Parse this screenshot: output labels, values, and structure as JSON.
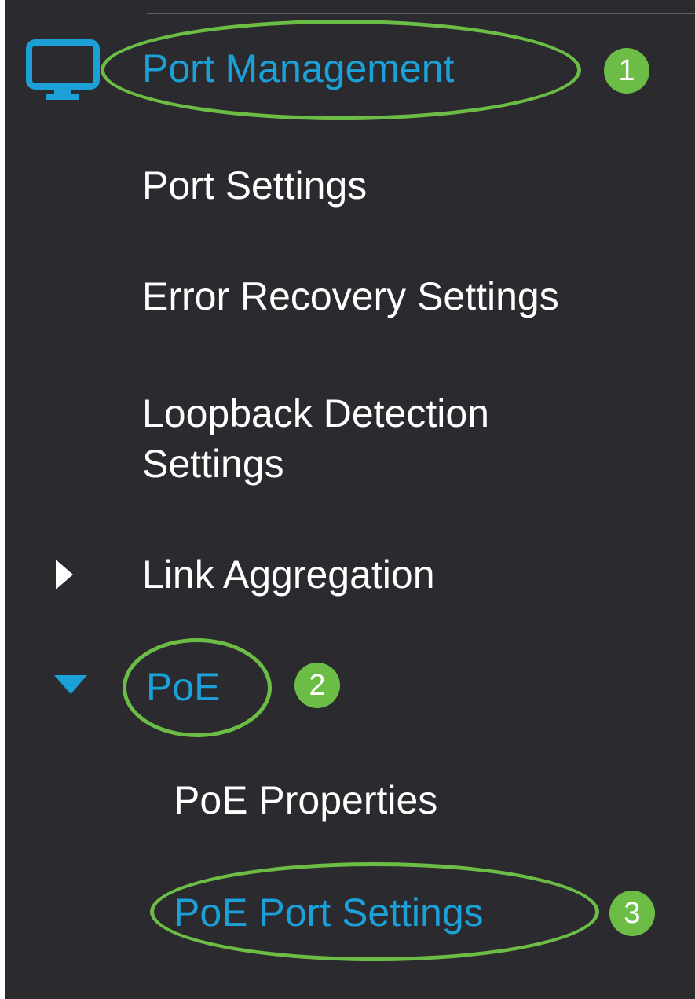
{
  "menu": {
    "section": {
      "label": "Port Management",
      "icon": "monitor-icon",
      "step": "1"
    },
    "items": [
      {
        "label": "Port Settings"
      },
      {
        "label": "Error Recovery Settings"
      },
      {
        "label_line1": "Loopback Detection",
        "label_line2": "Settings"
      },
      {
        "label": "Link Aggregation",
        "icon": "caret-right-icon",
        "expanded": false
      },
      {
        "label": "PoE",
        "icon": "caret-down-icon",
        "expanded": true,
        "step": "2"
      }
    ],
    "sub_items": [
      {
        "label": "PoE Properties"
      },
      {
        "label": "PoE Port Settings",
        "step": "3"
      }
    ]
  },
  "colors": {
    "background": "#2b2b2f",
    "text": "#ffffff",
    "active": "#1ba0d7",
    "highlight": "#6cbd45"
  }
}
